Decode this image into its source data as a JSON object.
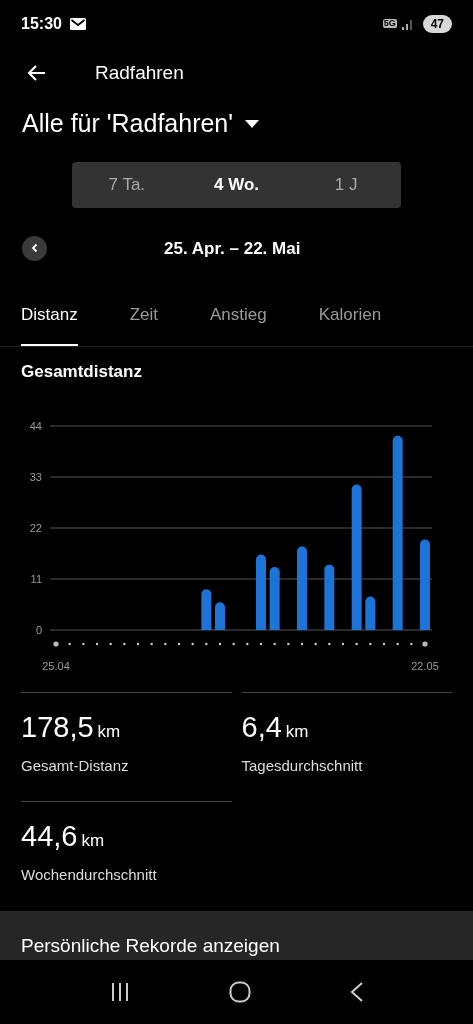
{
  "status_bar": {
    "time": "15:30",
    "network": "5G",
    "battery": "47"
  },
  "header": {
    "title": "Radfahren"
  },
  "filter": {
    "label": "Alle für 'Radfahren'"
  },
  "periods": [
    {
      "label": "7 Ta.",
      "selected": false
    },
    {
      "label": "4 Wo.",
      "selected": true
    },
    {
      "label": "1 J",
      "selected": false
    }
  ],
  "date_range": "25. Apr. – 22. Mai",
  "tabs": [
    {
      "label": "Distanz",
      "selected": true
    },
    {
      "label": "Zeit",
      "selected": false
    },
    {
      "label": "Anstieg",
      "selected": false
    },
    {
      "label": "Kalorien",
      "selected": false
    }
  ],
  "chart": {
    "title": "Gesamtdistanz",
    "chart_data": {
      "type": "bar",
      "categories": [
        "25.04",
        null,
        null,
        null,
        null,
        null,
        null,
        null,
        null,
        null,
        null,
        null,
        null,
        null,
        null,
        null,
        null,
        null,
        null,
        null,
        null,
        null,
        null,
        null,
        null,
        null,
        null,
        "22.05"
      ],
      "series": [
        {
          "color": "#1e74d6",
          "values": [
            0,
            0,
            0,
            0,
            0,
            0,
            0,
            0,
            0,
            0,
            0,
            8.8,
            6,
            0,
            0,
            16.3,
            13.6,
            0,
            18,
            0,
            14.1,
            0,
            31.4,
            7.2,
            0,
            41.9,
            0,
            19.5
          ]
        }
      ],
      "ylim": [
        0,
        44
      ],
      "grid": true,
      "yticks": [
        0,
        11,
        22,
        33,
        44
      ]
    }
  },
  "stats": [
    {
      "value": "178,5",
      "unit": "km",
      "label": "Gesamt-Distanz"
    },
    {
      "value": "6,4",
      "unit": "km",
      "label": "Tagesdurchschnitt"
    },
    {
      "value": "44,6",
      "unit": "km",
      "label": "Wochendurchschnitt"
    }
  ],
  "records_link": "Persönliche Rekorde anzeigen"
}
